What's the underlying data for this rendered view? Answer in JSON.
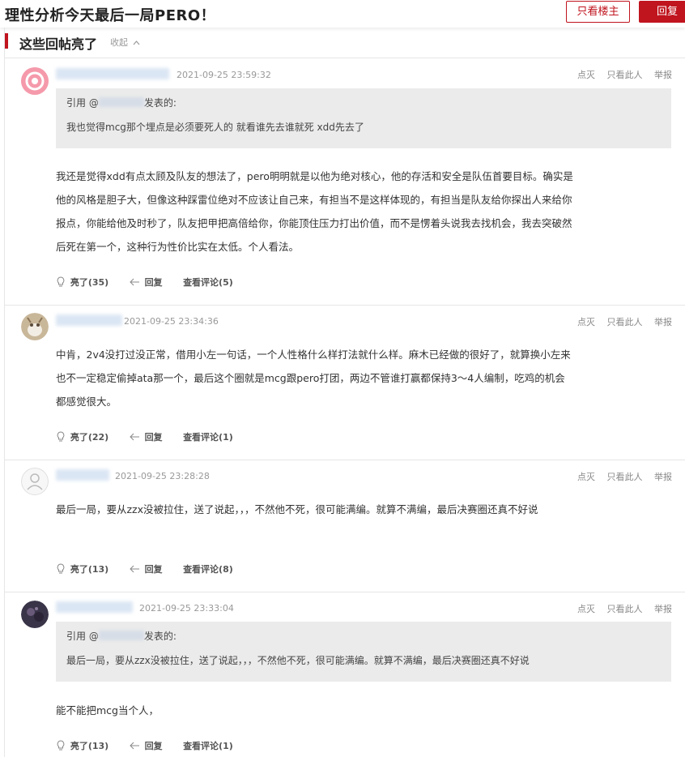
{
  "header": {
    "title": "理性分析今天最后一局PERO！",
    "only_owner": "只看楼主",
    "reply": "回复"
  },
  "section": {
    "title": "这些回帖亮了",
    "collapse": "收起"
  },
  "ops": {
    "light_off": "点灭",
    "only_this": "只看此人",
    "report": "举报"
  },
  "actions": {
    "reply": "回复"
  },
  "posts": [
    {
      "time": "2021-09-25 23:59:32",
      "quote": {
        "prefix": "引用 @",
        "suffix": "发表的:",
        "body": "我也觉得mcg那个埋点是必须要死人的 就看谁先去谁就死 xdd先去了"
      },
      "content": "我还是觉得xdd有点太顾及队友的想法了，pero明明就是以他为绝对核心，他的存活和安全是队伍首要目标。确实是他的风格是胆子大，但像这种踩雷位绝对不应该让自己来，有担当不是这样体现的，有担当是队友给你探出人来给你报点，你能给他及时秒了，队友把甲把高倍给你，你能顶住压力打出价值，而不是愣着头说我去找机会，我去突破然后死在第一个，这种行为性价比实在太低。个人看法。",
      "light": "亮了(35)",
      "comments": "查看评论(5)"
    },
    {
      "time": "2021-09-25 23:34:36",
      "content": "中肯，2v4没打过没正常，借用小左一句话，一个人性格什么样打法就什么样。麻木已经做的很好了，就算换小左来也不一定稳定偷掉ata那一个，最后这个圈就是mcg跟pero打团，两边不管谁打赢都保持3～4人编制，吃鸡的机会都感觉很大。",
      "light": "亮了(22)",
      "comments": "查看评论(1)"
    },
    {
      "time": "2021-09-25 23:28:28",
      "content": "最后一局，要从zzx没被拉住，送了说起，，，不然他不死，很可能满编。就算不满编，最后决赛圈还真不好说",
      "light": "亮了(13)",
      "comments": "查看评论(8)"
    },
    {
      "time": "2021-09-25 23:33:04",
      "quote": {
        "prefix": "引用 @",
        "suffix": "发表的:",
        "body": "最后一局，要从zzx没被拉住，送了说起，，，不然他不死，很可能满编。就算不满编，最后决赛圈还真不好说"
      },
      "content": "能不能把mcg当个人，",
      "light": "亮了(13)",
      "comments": "查看评论(1)"
    }
  ],
  "colors": {
    "accent": "#c0141e",
    "quote_bg": "#ebebeb",
    "name": "#7fa6d8"
  }
}
